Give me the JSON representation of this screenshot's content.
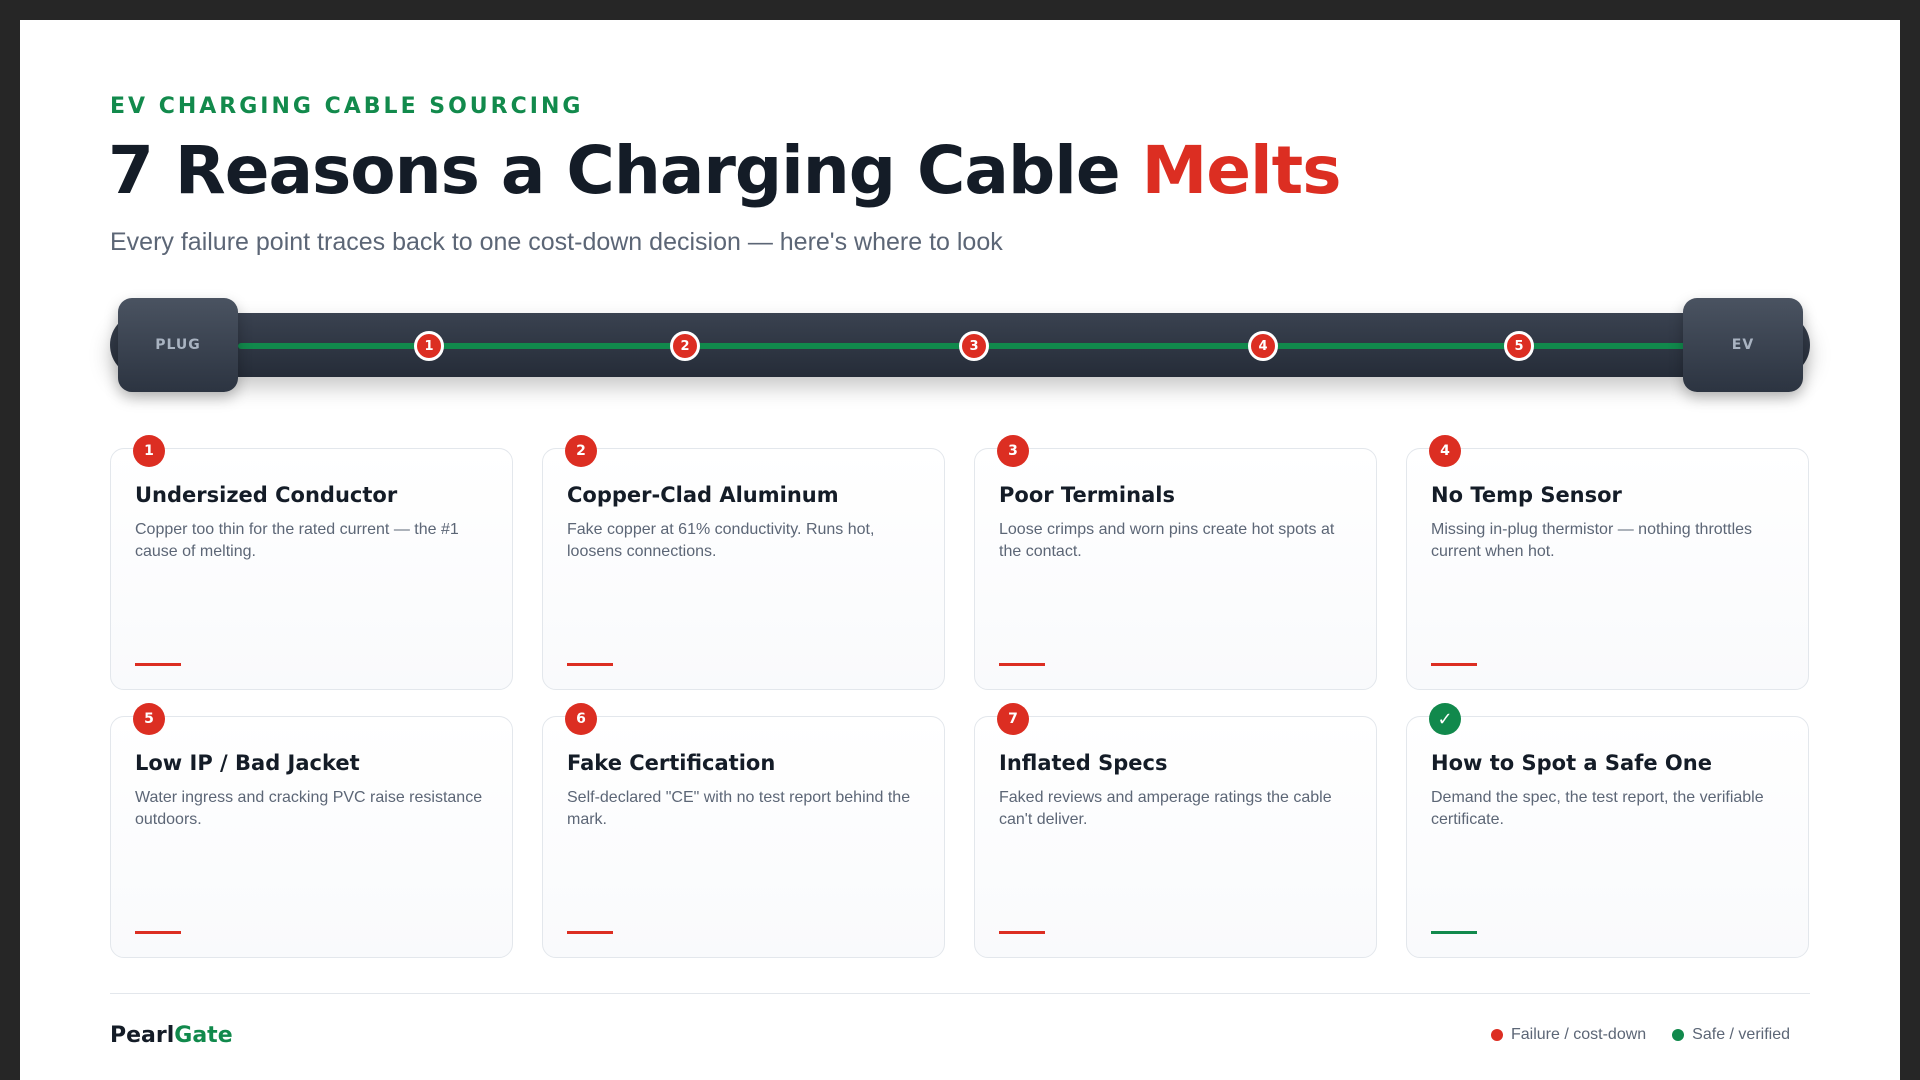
{
  "header": {
    "eyebrow": "EV CHARGING CABLE SOURCING",
    "title_main": "7 Reasons a Charging Cable ",
    "title_accent": "Melts",
    "subtitle": "Every failure point traces back to one cost-down decision — here's where to look"
  },
  "cable": {
    "left_label": "PLUG",
    "right_label": "EV",
    "markers": [
      "1",
      "2",
      "3",
      "4",
      "5"
    ]
  },
  "cards": [
    {
      "badge": "1",
      "title": "Undersized Conductor",
      "desc": "Copper too thin for the rated current — the #1 cause of melting."
    },
    {
      "badge": "2",
      "title": "Copper-Clad Aluminum",
      "desc": "Fake copper at 61% conductivity. Runs hot, loosens connections."
    },
    {
      "badge": "3",
      "title": "Poor Terminals",
      "desc": "Loose crimps and worn pins create hot spots at the contact."
    },
    {
      "badge": "4",
      "title": "No Temp Sensor",
      "desc": "Missing in-plug thermistor — nothing throttles current when hot."
    },
    {
      "badge": "5",
      "title": "Low IP / Bad Jacket",
      "desc": "Water ingress and cracking PVC raise resistance outdoors."
    },
    {
      "badge": "6",
      "title": "Fake Certification",
      "desc": "Self-declared \"CE\" with no test report behind the mark."
    },
    {
      "badge": "7",
      "title": "Inflated Specs",
      "desc": "Faked reviews and amperage ratings the cable can't deliver."
    },
    {
      "badge": "✓",
      "title": "How to Spot a Safe One",
      "desc": "Demand the spec, the test report, the verifiable certificate."
    }
  ],
  "footer": {
    "brand_part1": "Pearl",
    "brand_part2": "Gate",
    "legend": [
      {
        "label": "Failure / cost-down",
        "color": "#dc2e22"
      },
      {
        "label": "Safe / verified",
        "color": "#11894c"
      }
    ]
  },
  "colors": {
    "failure": "#dc2e22",
    "safe": "#11894c",
    "ink": "#141c27"
  }
}
